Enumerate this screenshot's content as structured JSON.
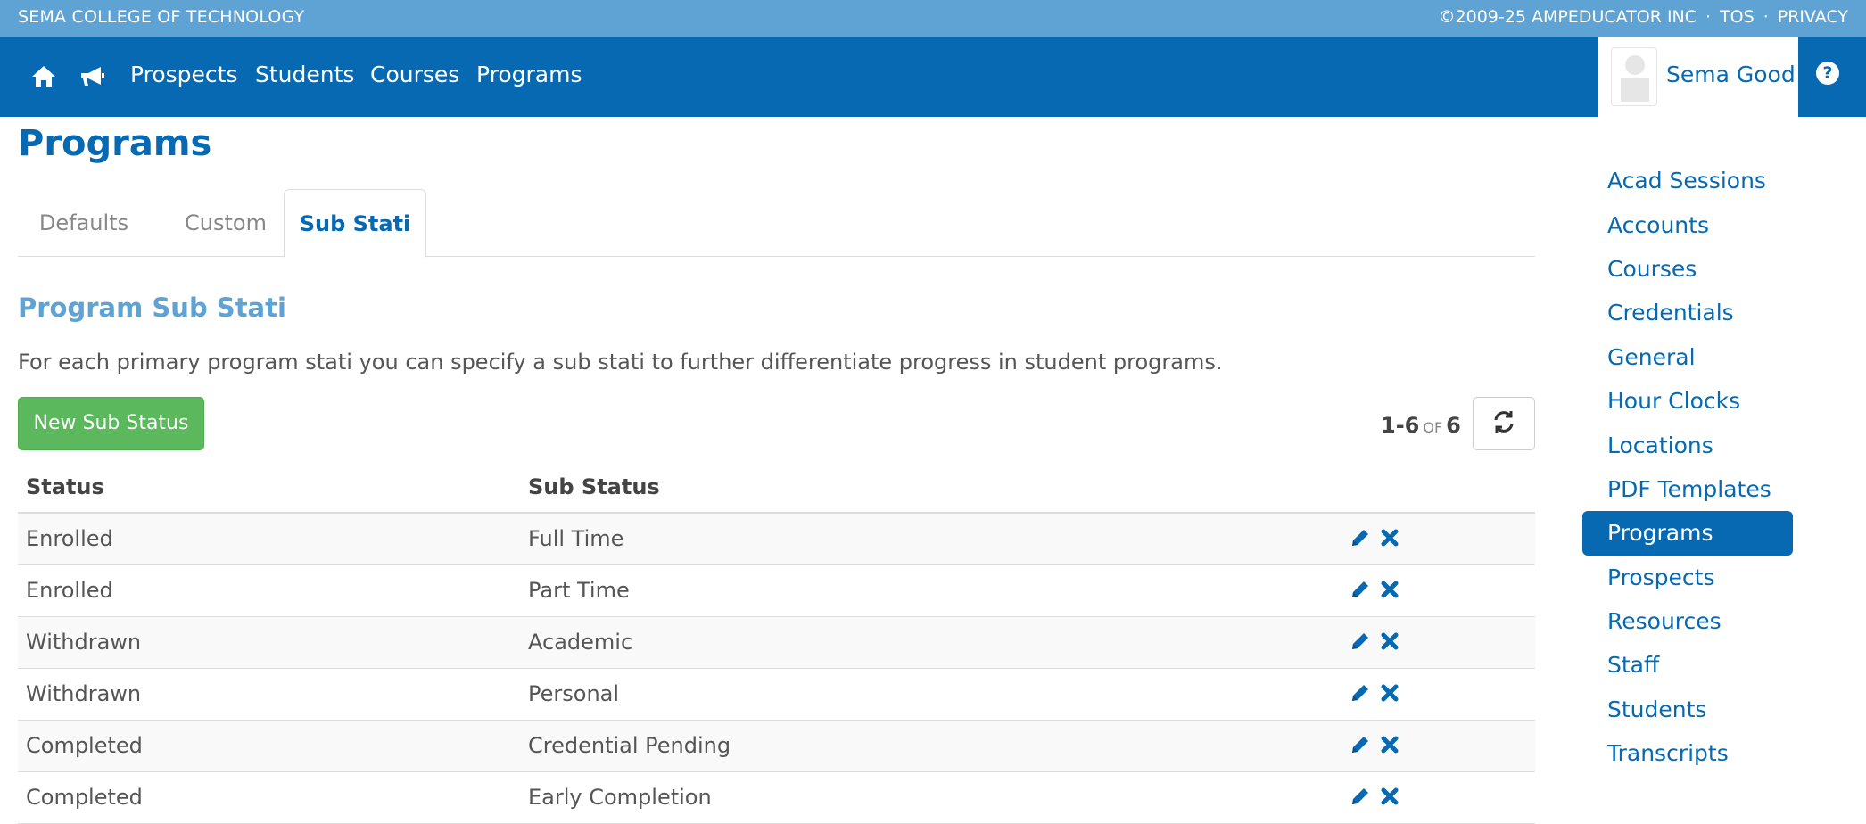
{
  "topbar": {
    "school": "SEMA COLLEGE OF TECHNOLOGY",
    "copyright": "©2009-25 AMPEDUCATOR INC",
    "sep": "·",
    "tos": "TOS",
    "privacy": "PRIVACY"
  },
  "nav": {
    "icons": [
      "home-icon",
      "megaphone-icon"
    ],
    "items": [
      "Prospects",
      "Students",
      "Courses",
      "Programs"
    ],
    "user_name": "Sema Good",
    "help_glyph": "?"
  },
  "page": {
    "title": "Programs",
    "tabs": [
      {
        "label": "Defaults",
        "active": false
      },
      {
        "label": "Custom",
        "active": false
      },
      {
        "label": "Sub Stati",
        "active": true
      }
    ],
    "section_title": "Program Sub Stati",
    "description": "For each primary program stati you can specify a sub stati to further differentiate progress in student programs.",
    "new_button": "New Sub Status",
    "pager": {
      "range": "1-6",
      "of": "OF",
      "total": "6"
    }
  },
  "table": {
    "headers": [
      "Status",
      "Sub Status"
    ],
    "rows": [
      {
        "status": "Enrolled",
        "sub_status": "Full Time"
      },
      {
        "status": "Enrolled",
        "sub_status": "Part Time"
      },
      {
        "status": "Withdrawn",
        "sub_status": "Academic"
      },
      {
        "status": "Withdrawn",
        "sub_status": "Personal"
      },
      {
        "status": "Completed",
        "sub_status": "Credential Pending"
      },
      {
        "status": "Completed",
        "sub_status": "Early Completion"
      }
    ]
  },
  "sidebar": {
    "items": [
      {
        "label": "Acad Sessions",
        "active": false
      },
      {
        "label": "Accounts",
        "active": false
      },
      {
        "label": "Courses",
        "active": false
      },
      {
        "label": "Credentials",
        "active": false
      },
      {
        "label": "General",
        "active": false
      },
      {
        "label": "Hour Clocks",
        "active": false
      },
      {
        "label": "Locations",
        "active": false
      },
      {
        "label": "PDF Templates",
        "active": false
      },
      {
        "label": "Programs",
        "active": true
      },
      {
        "label": "Prospects",
        "active": false
      },
      {
        "label": "Resources",
        "active": false
      },
      {
        "label": "Staff",
        "active": false
      },
      {
        "label": "Students",
        "active": false
      },
      {
        "label": "Transcripts",
        "active": false
      }
    ]
  },
  "colors": {
    "primary": "#0669b2",
    "topbar": "#5ea3d3",
    "success": "#5cb85c"
  }
}
